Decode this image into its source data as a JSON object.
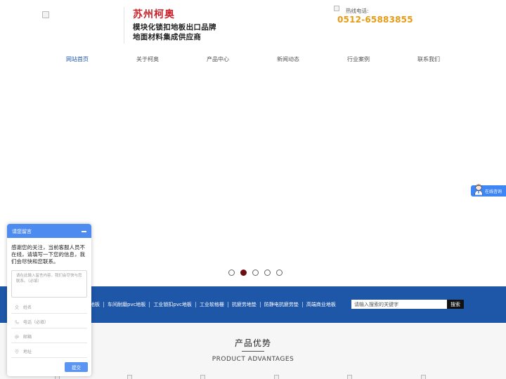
{
  "header": {
    "brand_name": "苏州柯奥",
    "slogan_line1": "模块化锁扣地板出口品牌",
    "slogan_line2": "地面材料集成供应商",
    "hotline_label": "热线电话:",
    "hotline_number": "0512-65883855"
  },
  "nav": {
    "items": [
      "网站首页",
      "关于柯奥",
      "产品中心",
      "新闻动态",
      "行业案例",
      "联系我们"
    ],
    "active_index": 0
  },
  "carousel": {
    "slide_count": 5,
    "active_index": 1
  },
  "keywords_bar": {
    "items": [
      "地板",
      "车间耐磨pvc地板",
      "工业锁扣pvc地板",
      "工业软格栅",
      "抗疲劳地垫",
      "防静电抗疲劳垫",
      "高端商业地板"
    ],
    "search_placeholder": "请输入搜索的关键字",
    "search_button": "搜索"
  },
  "advantages": {
    "title": "产品优势",
    "subtitle": "PRODUCT ADVANTAGES"
  },
  "consult": {
    "label": "在线咨询"
  },
  "message_widget": {
    "title": "请您留言",
    "notice": "感谢您的关注，当前客服人员不在线，请填写一下您的信息，我们会尽快和您联系。",
    "message_placeholder": "请在此输入留言内容，我们会尽快与您联系。（必填）",
    "name_placeholder": "姓名",
    "phone_placeholder": "电话（必填）",
    "email_placeholder": "邮箱",
    "address_placeholder": "地址",
    "submit_label": "提交"
  },
  "colors": {
    "brand_red": "#c8232a",
    "hotline_orange": "#e89a12",
    "band_blue": "#1f57a8",
    "widget_blue": "#4e8bf0",
    "active_dot": "#6b0f13"
  }
}
